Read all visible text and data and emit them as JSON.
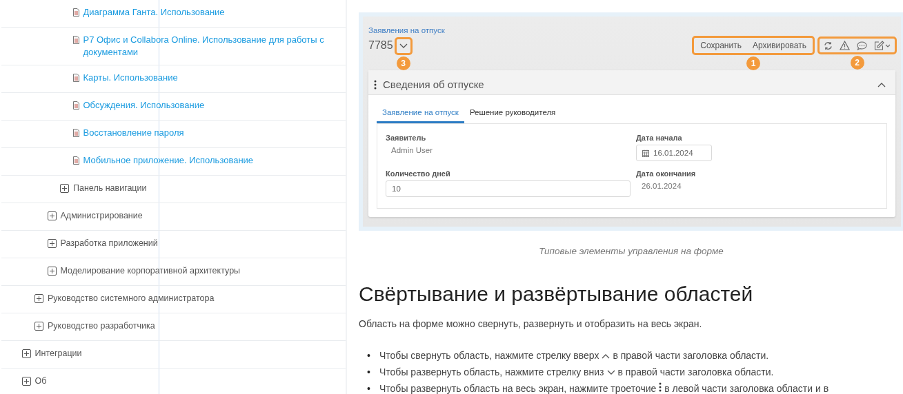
{
  "tree": [
    {
      "children": [
        {
          "children": [
            {
              "children": [
                {
                  "children": [
                    {
                      "label": "Диаграмма Ганта. Использование",
                      "kind": "doc"
                    },
                    {
                      "label": "Р7 Офис и Collabora Online. Использование для работы с документами",
                      "kind": "doc"
                    },
                    {
                      "label": "Карты. Использование",
                      "kind": "doc"
                    },
                    {
                      "label": "Обсуждения. Использование",
                      "kind": "doc"
                    },
                    {
                      "label": "Восстановление пароля",
                      "kind": "doc"
                    },
                    {
                      "label": "Мобильное приложение. Использование",
                      "kind": "doc"
                    }
                  ]
                },
                {
                  "label": "Панель навигации",
                  "kind": "folder",
                  "expanded": false
                }
              ]
            },
            {
              "label": "Администрирование",
              "kind": "folder",
              "expanded": false
            },
            {
              "label": "Разработка приложений",
              "kind": "folder",
              "expanded": false
            },
            {
              "label": "Моделирование корпоративной архитектуры",
              "kind": "folder",
              "expanded": false
            }
          ]
        },
        {
          "label": "Руководство системного администратора",
          "kind": "folder",
          "expanded": false
        },
        {
          "label": "Руководство разработчика",
          "kind": "folder",
          "expanded": false
        }
      ]
    },
    {
      "label": "Интеграции",
      "kind": "folder",
      "expanded": false
    },
    {
      "label": "Об",
      "kind": "folder",
      "expanded": false
    }
  ],
  "figure": {
    "breadcrumb": "Заявления на отпуск",
    "record_number": "7785",
    "actions": [
      "Сохранить",
      "Архивировать"
    ],
    "callouts": [
      "3",
      "1",
      "2"
    ],
    "card": {
      "title": "Сведения об отпуске",
      "expanded": true,
      "tabs": [
        {
          "label": "Заявление на отпуск",
          "selected": true
        },
        {
          "label": "Решение руководителя",
          "selected": false
        }
      ],
      "fields": [
        {
          "label": "Заявитель",
          "value": "Admin User",
          "kind": "text"
        },
        {
          "label": "Дата начала",
          "value": "16.01.2024",
          "kind": "date"
        },
        {
          "label": "Количество дней",
          "value": "10",
          "kind": "input"
        },
        {
          "label": "Дата окончания",
          "value": "26.01.2024",
          "kind": "text"
        }
      ]
    }
  },
  "caption": "Типовые элементы управления на форме",
  "heading": "Свёртывание и развёртывание областей",
  "intro": "Область на форме можно свернуть, развернуть и отобразить на весь экран.",
  "bullets": [
    {
      "marker": "•",
      "before": "Чтобы свернуть область, нажмите стрелку вверх",
      "kind": "up",
      "after": "в правой части заголовка области."
    },
    {
      "marker": "•",
      "before": "Чтобы развернуть область, нажмите стрелку вниз",
      "kind": "down",
      "after": "в правой части заголовка области."
    },
    {
      "marker": "•",
      "before": "Чтобы развернуть область на весь экран, нажмите троеточие",
      "kind": "dots",
      "after": "в левой части заголовка области и в"
    }
  ]
}
